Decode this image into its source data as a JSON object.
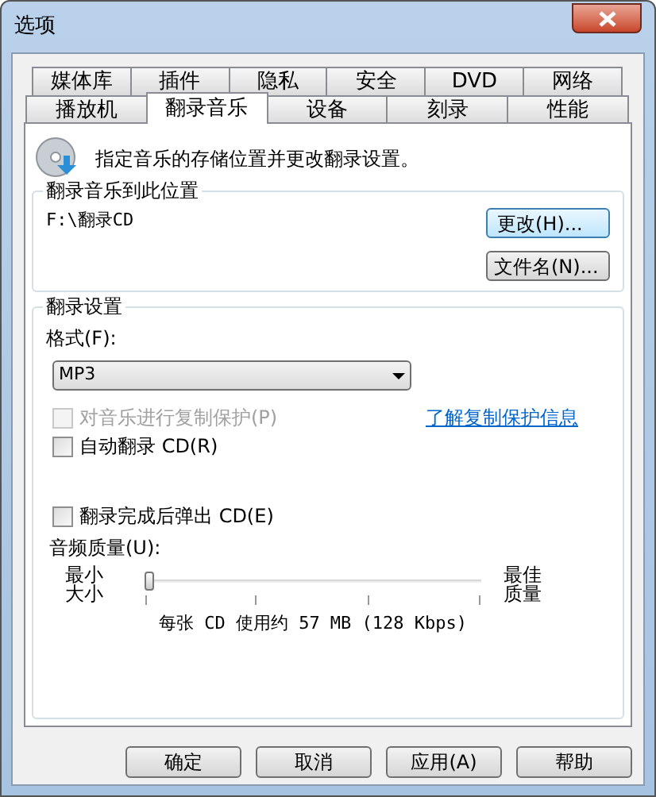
{
  "window": {
    "title": "选项"
  },
  "tab_rows": [
    {
      "tabs": [
        {
          "label": "媒体库",
          "selected": false
        },
        {
          "label": "插件",
          "selected": false
        },
        {
          "label": "隐私",
          "selected": false
        },
        {
          "label": "安全",
          "selected": false
        },
        {
          "label": "DVD",
          "selected": false
        },
        {
          "label": "网络",
          "selected": false
        }
      ]
    },
    {
      "tabs": [
        {
          "label": "播放机",
          "selected": false
        },
        {
          "label": "翻录音乐",
          "selected": true
        },
        {
          "label": "设备",
          "selected": false
        },
        {
          "label": "刻录",
          "selected": false
        },
        {
          "label": "性能",
          "selected": false
        }
      ]
    }
  ],
  "intro": "指定音乐的存储位置并更改翻录设置。",
  "location": {
    "title": "翻录音乐到此位置",
    "path": "F:\\翻录CD",
    "change_button": "更改(H)...",
    "filename_button": "文件名(N)..."
  },
  "settings": {
    "title": "翻录设置",
    "format_label": "格式(F):",
    "format_value": "MP3",
    "copy_protect": {
      "label": "对音乐进行复制保护(P)",
      "checked": false,
      "disabled": true
    },
    "copy_link": "了解复制保护信息",
    "auto_rip": {
      "label": "自动翻录 CD(R)",
      "checked": false,
      "disabled": false
    },
    "eject": {
      "label": "翻录完成后弹出 CD(E)",
      "checked": false,
      "disabled": false
    },
    "quality_label": "音频质量(U):",
    "min_label": [
      "最小",
      "大小"
    ],
    "max_label": [
      "最佳",
      "质量"
    ],
    "quality": {
      "level": 0
    },
    "quality_reading": "每张 CD 使用约 57 MB (128 Kbps)"
  },
  "buttons": [
    "确定",
    "取消",
    "应用(A)",
    "帮助"
  ]
}
